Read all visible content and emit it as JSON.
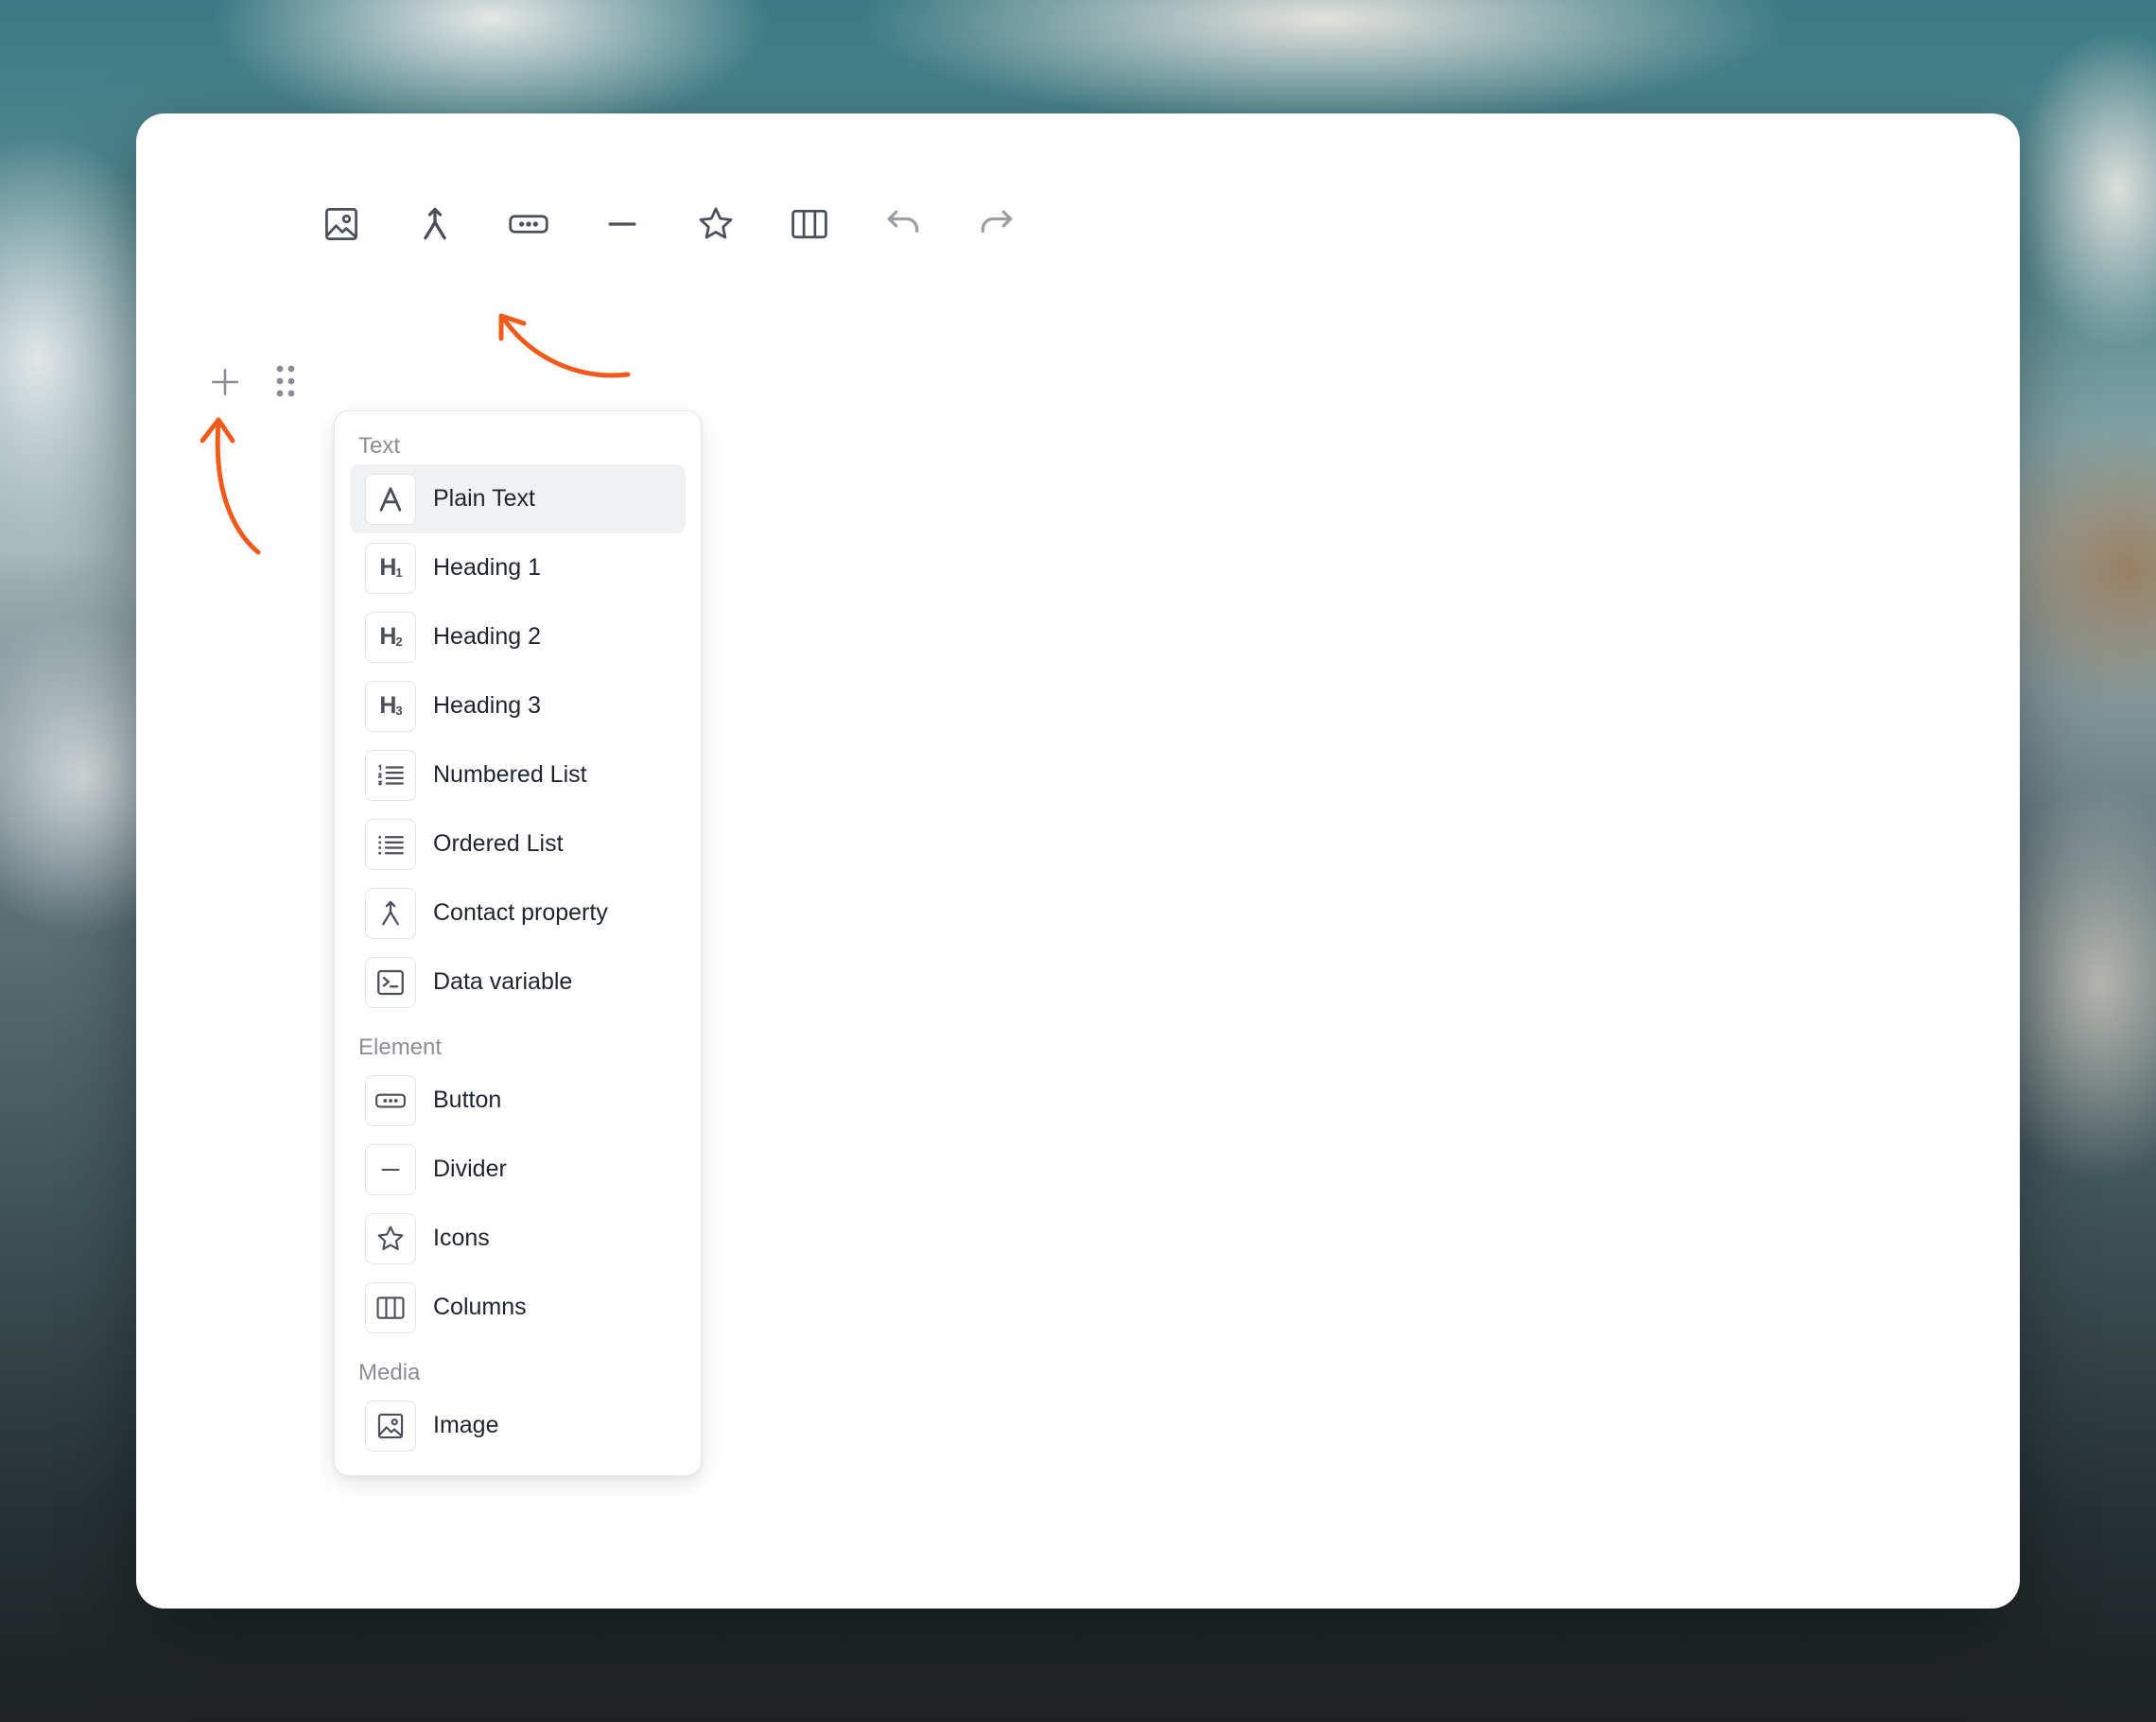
{
  "colors": {
    "accent": "#f05a1a",
    "icon": "#4a4f59",
    "muted_icon": "#9ea2aa",
    "group_label": "#8b8e96"
  },
  "toolbar": {
    "buttons": [
      {
        "icon": "image-icon"
      },
      {
        "icon": "merge-icon"
      },
      {
        "icon": "button-icon"
      },
      {
        "icon": "divider-icon"
      },
      {
        "icon": "star-icon"
      },
      {
        "icon": "columns-icon"
      },
      {
        "icon": "undo-icon"
      },
      {
        "icon": "redo-icon"
      }
    ]
  },
  "block_controls": {
    "add_icon": "plus-icon",
    "drag_icon": "drag-dots-icon"
  },
  "menu": {
    "groups": [
      {
        "label": "Text",
        "items": [
          {
            "label": "Plain Text",
            "icon": "text-a-icon",
            "active": true
          },
          {
            "label": "Heading 1",
            "icon": "heading-1-icon",
            "glyph": "H",
            "sub": "1"
          },
          {
            "label": "Heading 2",
            "icon": "heading-2-icon",
            "glyph": "H",
            "sub": "2"
          },
          {
            "label": "Heading 3",
            "icon": "heading-3-icon",
            "glyph": "H",
            "sub": "3"
          },
          {
            "label": "Numbered List",
            "icon": "numbered-list-icon"
          },
          {
            "label": "Ordered List",
            "icon": "bullet-list-icon"
          },
          {
            "label": "Contact property",
            "icon": "merge-icon"
          },
          {
            "label": "Data variable",
            "icon": "terminal-icon"
          }
        ]
      },
      {
        "label": "Element",
        "items": [
          {
            "label": "Button",
            "icon": "button-icon"
          },
          {
            "label": "Divider",
            "icon": "divider-icon"
          },
          {
            "label": "Icons",
            "icon": "star-icon"
          },
          {
            "label": "Columns",
            "icon": "columns-icon"
          }
        ]
      },
      {
        "label": "Media",
        "items": [
          {
            "label": "Image",
            "icon": "image-icon"
          }
        ]
      }
    ]
  }
}
